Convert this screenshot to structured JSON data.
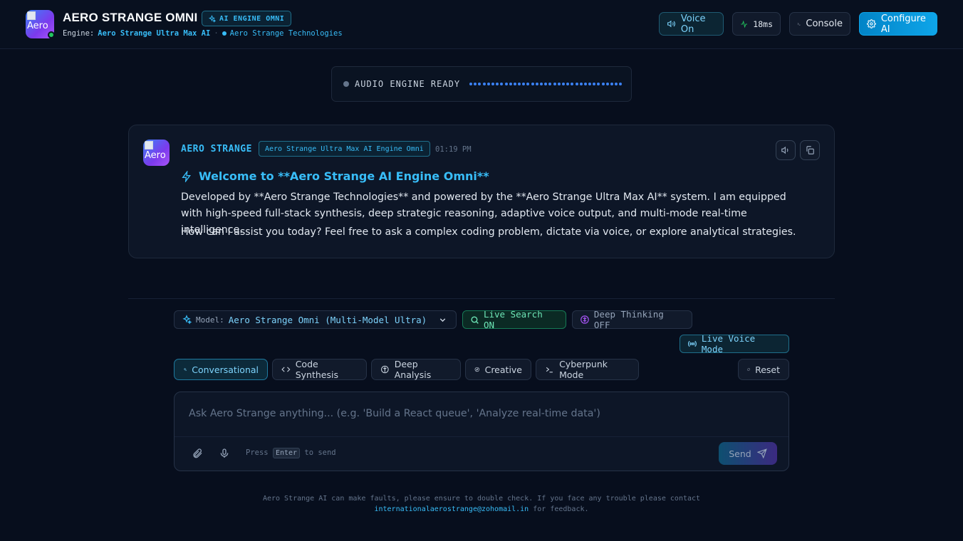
{
  "header": {
    "logo_alt": "Aero",
    "title": "AERO STRANGE OMNI",
    "engine_badge": "AI ENGINE OMNI",
    "engine_prefix": "Engine:",
    "engine_name": "Aero Strange Ultra Max AI",
    "separator": "·",
    "company": "Aero Strange Technologies",
    "voice_button": "Voice On",
    "latency": "18ms",
    "console_button": "Console",
    "configure_button": "Configure AI"
  },
  "audio": {
    "status": "AUDIO ENGINE READY"
  },
  "message": {
    "avatar_alt": "Aero",
    "sender": "AERO STRANGE",
    "model_tag": "Aero Strange Ultra Max AI Engine Omni",
    "time": "01:19 PM",
    "headline": "Welcome to **Aero Strange AI Engine Omni**",
    "paragraph1": "Developed by **Aero Strange Technologies** and powered by the **Aero Strange Ultra Max AI** system. I am equipped with high-speed full-stack synthesis, deep strategic reasoning, adaptive voice output, and multi-mode real-time intelligence.",
    "paragraph2": "How can I assist you today? Feel free to ask a complex coding problem, dictate via voice, or explore analytical strategies."
  },
  "controls": {
    "model_label": "Model:",
    "model_value": "Aero Strange Omni (Multi-Model Ultra)",
    "live_search": "Live Search ON",
    "deep_thinking": "Deep Thinking OFF",
    "live_voice": "Live Voice Mode"
  },
  "modes": {
    "conversational": "Conversational",
    "code": "Code Synthesis",
    "analysis": "Deep Analysis",
    "creative": "Creative",
    "cyberpunk": "Cyberpunk Mode",
    "reset": "Reset",
    "active": "Conversational"
  },
  "composer": {
    "placeholder": "Ask Aero Strange anything... (e.g. 'Build a React queue', 'Analyze real-time data')",
    "hint_prefix": "Press",
    "hint_key": "Enter",
    "hint_suffix": "to send",
    "send": "Send"
  },
  "footer": {
    "line1": "Aero Strange AI can make faults, please ensure to double check. If you face any trouble please contact",
    "email": "internationalaerostrange@zohomail.in",
    "line2_suffix": "for feedback."
  },
  "colors": {
    "accent": "#38bdf8",
    "background": "#070e1d",
    "status_online": "#22c55e",
    "search_on": "#6ee7b7"
  }
}
